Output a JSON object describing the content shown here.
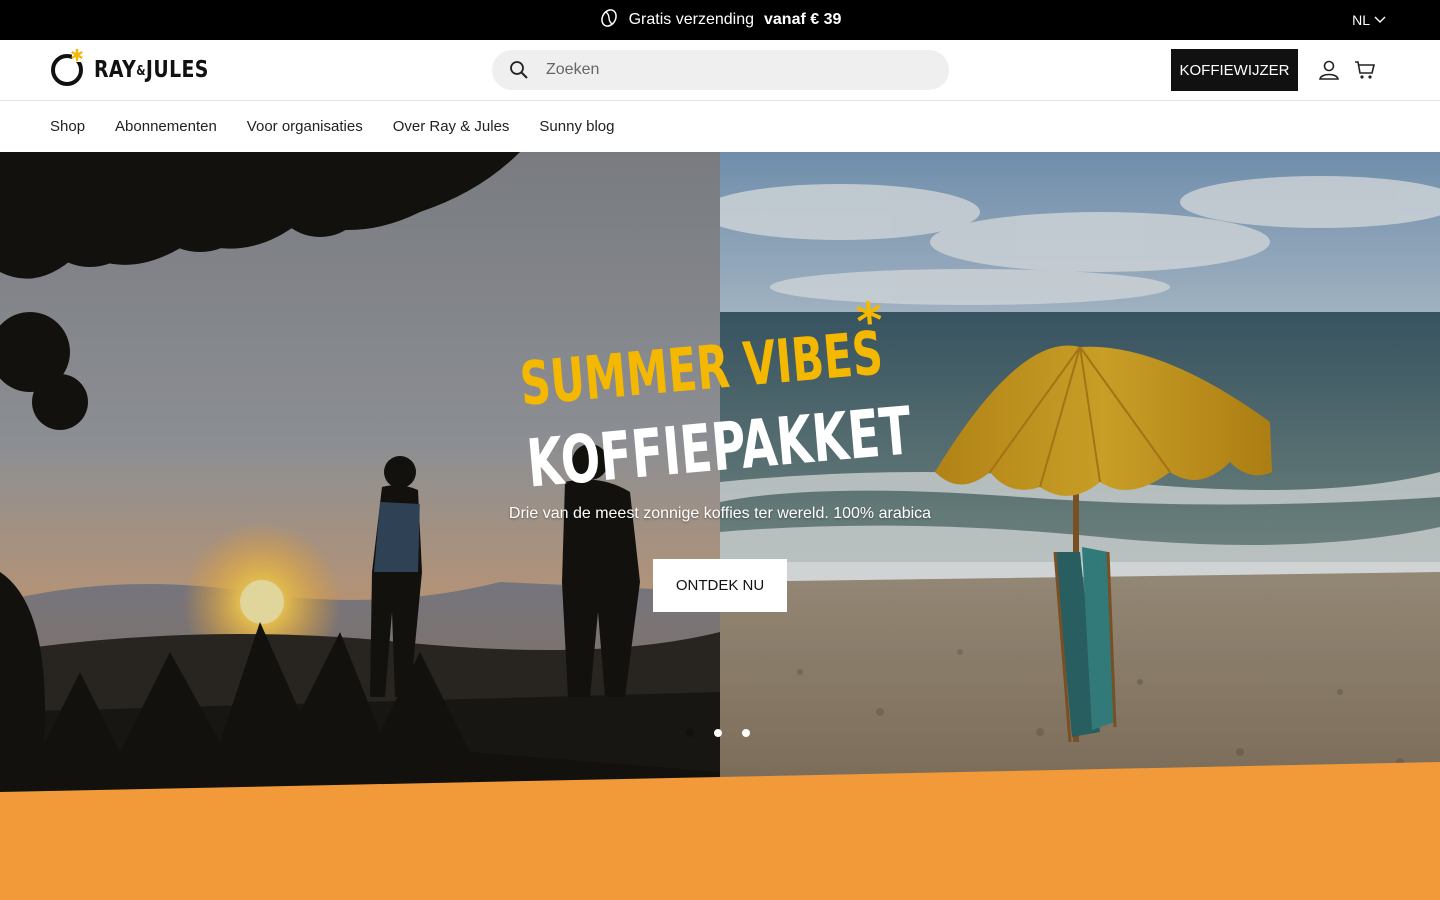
{
  "announcement": {
    "text_before": "Gratis verzending",
    "text_bold": "vanaf € 39",
    "icon": "coffee-bean-icon",
    "language": "NL"
  },
  "header": {
    "logo_text_1": "RAY",
    "logo_amp": "&",
    "logo_text_2": "JULES",
    "search_placeholder": "Zoeken",
    "wizard_label": "KOFFIEWIJZER",
    "account_icon": "user-icon",
    "cart_icon": "cart-icon"
  },
  "nav": {
    "items": [
      {
        "label": "Shop"
      },
      {
        "label": "Abonnementen"
      },
      {
        "label": "Voor organisaties"
      },
      {
        "label": "Over Ray & Jules"
      },
      {
        "label": "Sunny blog"
      }
    ]
  },
  "hero": {
    "title_line1": "SUMMER VIBES",
    "title_star": "*",
    "title_line2": "KOFFIEPAKKET",
    "subtitle": "Drie van de meest zonnige koffies ter wereld. 100% arabica",
    "button_label": "ONTDEK NU",
    "slides_total": 3,
    "active_slide": 1
  },
  "colors": {
    "accent_yellow": "#F5B800",
    "orange_band": "#F29A3A",
    "dark": "#111111"
  }
}
